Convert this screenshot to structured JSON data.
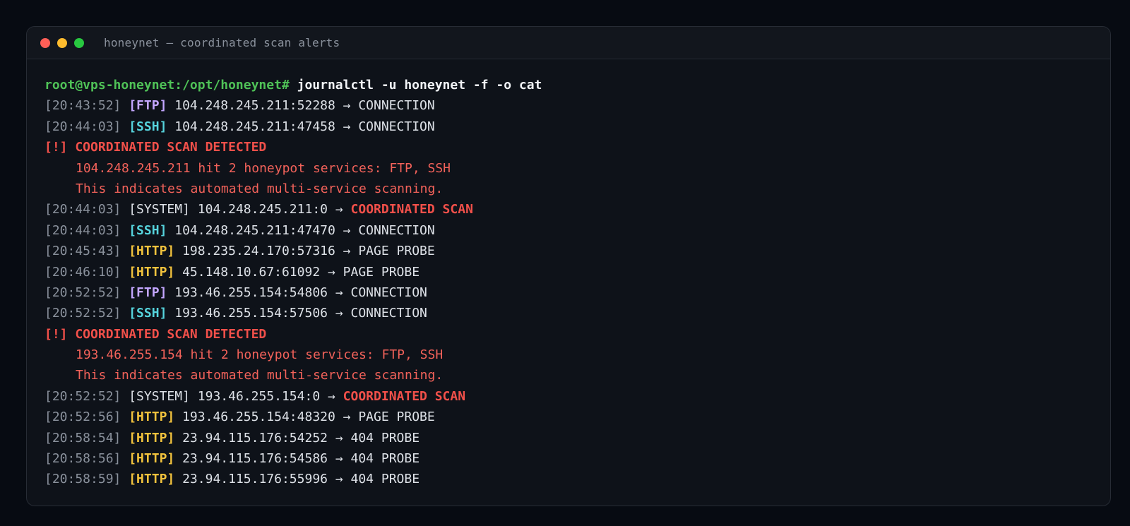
{
  "window": {
    "title": "honeynet — coordinated scan alerts",
    "buttons": [
      {
        "name": "close",
        "color": "#ff5f57"
      },
      {
        "name": "minimize",
        "color": "#febc2e"
      },
      {
        "name": "zoom",
        "color": "#28c840"
      }
    ]
  },
  "colors": {
    "FTP": "#c3a6ff",
    "SSH": "#56d4dd",
    "HTTP": "#f2c33d",
    "SYSTEM": "#dde1e7"
  },
  "terminal": {
    "prompt": "root@vps-honeynet:/opt/honeynet#",
    "command": "journalctl -u honeynet -f -o cat",
    "lines": [
      {
        "type": "log",
        "time": "[20:43:52]",
        "tag": "[FTP]",
        "service": "FTP",
        "text": "104.248.245.211:52288 → CONNECTION"
      },
      {
        "type": "log",
        "time": "[20:44:03]",
        "tag": "[SSH]",
        "service": "SSH",
        "text": "104.248.245.211:47458 → CONNECTION"
      },
      {
        "type": "alert",
        "text": "[!] COORDINATED SCAN DETECTED"
      },
      {
        "type": "detail",
        "text": "104.248.245.211 hit 2 honeypot services: FTP, SSH"
      },
      {
        "type": "detail",
        "text": "This indicates automated multi-service scanning."
      },
      {
        "type": "log",
        "time": "[20:44:03]",
        "tag": "[SYSTEM]",
        "service": "SYSTEM",
        "text": "104.248.245.211:0 → ",
        "highlight": "COORDINATED SCAN"
      },
      {
        "type": "log",
        "time": "[20:44:03]",
        "tag": "[SSH]",
        "service": "SSH",
        "text": "104.248.245.211:47470 → CONNECTION"
      },
      {
        "type": "log",
        "time": "[20:45:43]",
        "tag": "[HTTP]",
        "service": "HTTP",
        "text": "198.235.24.170:57316 → PAGE PROBE"
      },
      {
        "type": "log",
        "time": "[20:46:10]",
        "tag": "[HTTP]",
        "service": "HTTP",
        "text": "45.148.10.67:61092 → PAGE PROBE"
      },
      {
        "type": "log",
        "time": "[20:52:52]",
        "tag": "[FTP]",
        "service": "FTP",
        "text": "193.46.255.154:54806 → CONNECTION"
      },
      {
        "type": "log",
        "time": "[20:52:52]",
        "tag": "[SSH]",
        "service": "SSH",
        "text": "193.46.255.154:57506 → CONNECTION"
      },
      {
        "type": "alert",
        "text": "[!] COORDINATED SCAN DETECTED"
      },
      {
        "type": "detail",
        "text": "193.46.255.154 hit 2 honeypot services: FTP, SSH"
      },
      {
        "type": "detail",
        "text": "This indicates automated multi-service scanning."
      },
      {
        "type": "log",
        "time": "[20:52:52]",
        "tag": "[SYSTEM]",
        "service": "SYSTEM",
        "text": "193.46.255.154:0 → ",
        "highlight": "COORDINATED SCAN"
      },
      {
        "type": "log",
        "time": "[20:52:56]",
        "tag": "[HTTP]",
        "service": "HTTP",
        "text": "193.46.255.154:48320 → PAGE PROBE"
      },
      {
        "type": "log",
        "time": "[20:58:54]",
        "tag": "[HTTP]",
        "service": "HTTP",
        "text": "23.94.115.176:54252 → 404 PROBE"
      },
      {
        "type": "log",
        "time": "[20:58:56]",
        "tag": "[HTTP]",
        "service": "HTTP",
        "text": "23.94.115.176:54586 → 404 PROBE"
      },
      {
        "type": "log",
        "time": "[20:58:59]",
        "tag": "[HTTP]",
        "service": "HTTP",
        "text": "23.94.115.176:55996 → 404 PROBE"
      }
    ]
  }
}
